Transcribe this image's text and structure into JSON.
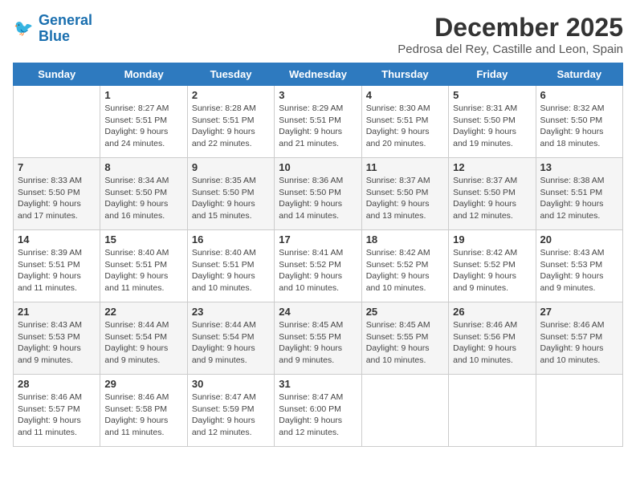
{
  "header": {
    "logo_line1": "General",
    "logo_line2": "Blue",
    "month": "December 2025",
    "location": "Pedrosa del Rey, Castille and Leon, Spain"
  },
  "days_of_week": [
    "Sunday",
    "Monday",
    "Tuesday",
    "Wednesday",
    "Thursday",
    "Friday",
    "Saturday"
  ],
  "weeks": [
    [
      {
        "day": "",
        "text": ""
      },
      {
        "day": "1",
        "text": "Sunrise: 8:27 AM\nSunset: 5:51 PM\nDaylight: 9 hours\nand 24 minutes."
      },
      {
        "day": "2",
        "text": "Sunrise: 8:28 AM\nSunset: 5:51 PM\nDaylight: 9 hours\nand 22 minutes."
      },
      {
        "day": "3",
        "text": "Sunrise: 8:29 AM\nSunset: 5:51 PM\nDaylight: 9 hours\nand 21 minutes."
      },
      {
        "day": "4",
        "text": "Sunrise: 8:30 AM\nSunset: 5:51 PM\nDaylight: 9 hours\nand 20 minutes."
      },
      {
        "day": "5",
        "text": "Sunrise: 8:31 AM\nSunset: 5:50 PM\nDaylight: 9 hours\nand 19 minutes."
      },
      {
        "day": "6",
        "text": "Sunrise: 8:32 AM\nSunset: 5:50 PM\nDaylight: 9 hours\nand 18 minutes."
      }
    ],
    [
      {
        "day": "7",
        "text": "Sunrise: 8:33 AM\nSunset: 5:50 PM\nDaylight: 9 hours\nand 17 minutes."
      },
      {
        "day": "8",
        "text": "Sunrise: 8:34 AM\nSunset: 5:50 PM\nDaylight: 9 hours\nand 16 minutes."
      },
      {
        "day": "9",
        "text": "Sunrise: 8:35 AM\nSunset: 5:50 PM\nDaylight: 9 hours\nand 15 minutes."
      },
      {
        "day": "10",
        "text": "Sunrise: 8:36 AM\nSunset: 5:50 PM\nDaylight: 9 hours\nand 14 minutes."
      },
      {
        "day": "11",
        "text": "Sunrise: 8:37 AM\nSunset: 5:50 PM\nDaylight: 9 hours\nand 13 minutes."
      },
      {
        "day": "12",
        "text": "Sunrise: 8:37 AM\nSunset: 5:50 PM\nDaylight: 9 hours\nand 12 minutes."
      },
      {
        "day": "13",
        "text": "Sunrise: 8:38 AM\nSunset: 5:51 PM\nDaylight: 9 hours\nand 12 minutes."
      }
    ],
    [
      {
        "day": "14",
        "text": "Sunrise: 8:39 AM\nSunset: 5:51 PM\nDaylight: 9 hours\nand 11 minutes."
      },
      {
        "day": "15",
        "text": "Sunrise: 8:40 AM\nSunset: 5:51 PM\nDaylight: 9 hours\nand 11 minutes."
      },
      {
        "day": "16",
        "text": "Sunrise: 8:40 AM\nSunset: 5:51 PM\nDaylight: 9 hours\nand 10 minutes."
      },
      {
        "day": "17",
        "text": "Sunrise: 8:41 AM\nSunset: 5:52 PM\nDaylight: 9 hours\nand 10 minutes."
      },
      {
        "day": "18",
        "text": "Sunrise: 8:42 AM\nSunset: 5:52 PM\nDaylight: 9 hours\nand 10 minutes."
      },
      {
        "day": "19",
        "text": "Sunrise: 8:42 AM\nSunset: 5:52 PM\nDaylight: 9 hours\nand 9 minutes."
      },
      {
        "day": "20",
        "text": "Sunrise: 8:43 AM\nSunset: 5:53 PM\nDaylight: 9 hours\nand 9 minutes."
      }
    ],
    [
      {
        "day": "21",
        "text": "Sunrise: 8:43 AM\nSunset: 5:53 PM\nDaylight: 9 hours\nand 9 minutes."
      },
      {
        "day": "22",
        "text": "Sunrise: 8:44 AM\nSunset: 5:54 PM\nDaylight: 9 hours\nand 9 minutes."
      },
      {
        "day": "23",
        "text": "Sunrise: 8:44 AM\nSunset: 5:54 PM\nDaylight: 9 hours\nand 9 minutes."
      },
      {
        "day": "24",
        "text": "Sunrise: 8:45 AM\nSunset: 5:55 PM\nDaylight: 9 hours\nand 9 minutes."
      },
      {
        "day": "25",
        "text": "Sunrise: 8:45 AM\nSunset: 5:55 PM\nDaylight: 9 hours\nand 10 minutes."
      },
      {
        "day": "26",
        "text": "Sunrise: 8:46 AM\nSunset: 5:56 PM\nDaylight: 9 hours\nand 10 minutes."
      },
      {
        "day": "27",
        "text": "Sunrise: 8:46 AM\nSunset: 5:57 PM\nDaylight: 9 hours\nand 10 minutes."
      }
    ],
    [
      {
        "day": "28",
        "text": "Sunrise: 8:46 AM\nSunset: 5:57 PM\nDaylight: 9 hours\nand 11 minutes."
      },
      {
        "day": "29",
        "text": "Sunrise: 8:46 AM\nSunset: 5:58 PM\nDaylight: 9 hours\nand 11 minutes."
      },
      {
        "day": "30",
        "text": "Sunrise: 8:47 AM\nSunset: 5:59 PM\nDaylight: 9 hours\nand 12 minutes."
      },
      {
        "day": "31",
        "text": "Sunrise: 8:47 AM\nSunset: 6:00 PM\nDaylight: 9 hours\nand 12 minutes."
      },
      {
        "day": "",
        "text": ""
      },
      {
        "day": "",
        "text": ""
      },
      {
        "day": "",
        "text": ""
      }
    ]
  ]
}
